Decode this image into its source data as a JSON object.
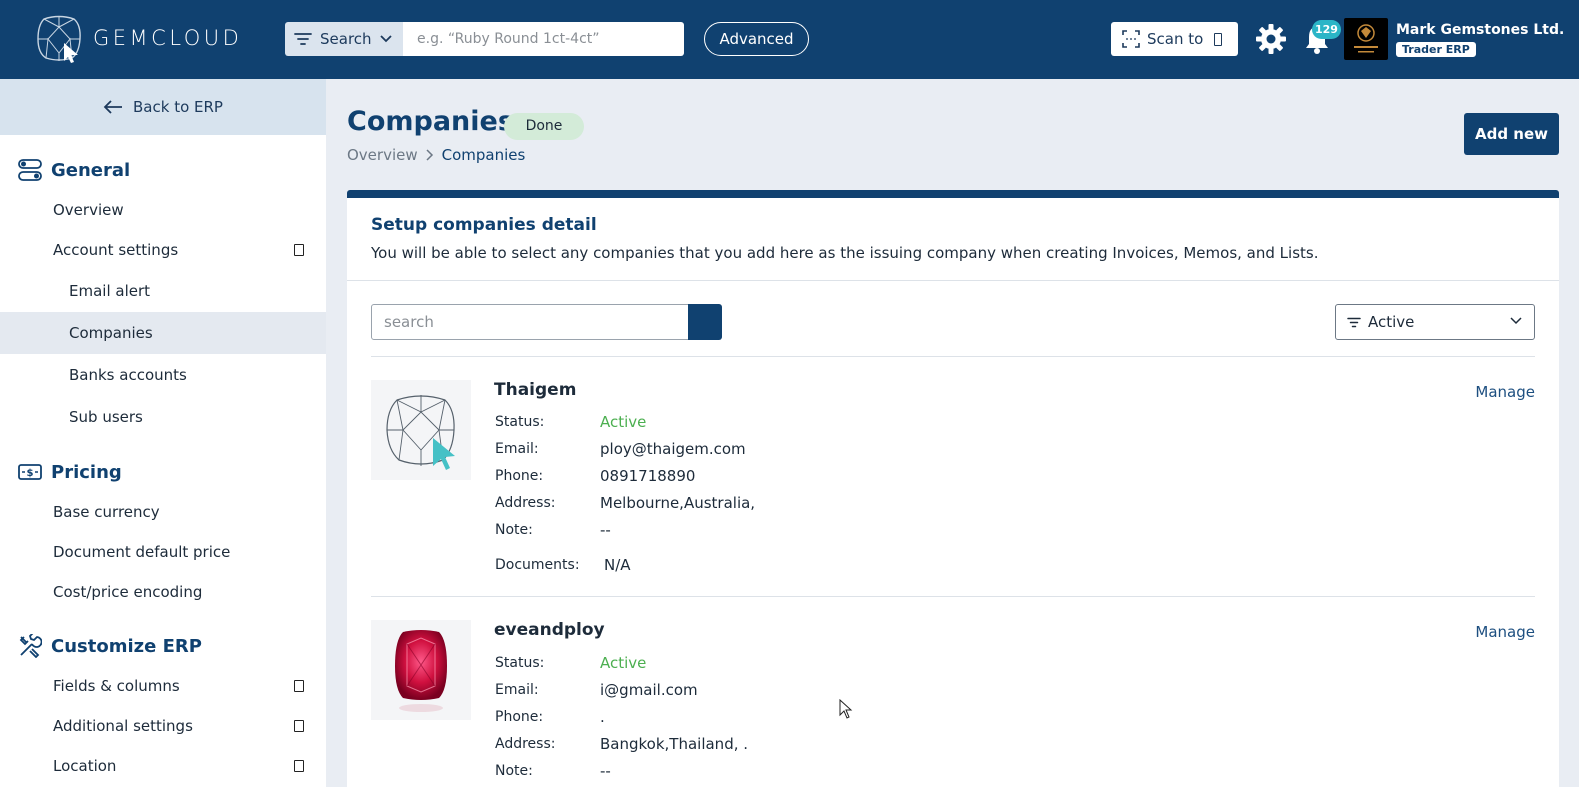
{
  "header": {
    "brand": "GEMCLOUD",
    "search_type_label": "Search",
    "search_placeholder": "e.g. “Ruby Round 1ct-4ct”",
    "advanced_label": "Advanced",
    "scan_label": "Scan to",
    "notification_count": "129",
    "company_name": "Mark Gemstones Ltd.",
    "company_tag": "Trader ERP",
    "accent": "#104170"
  },
  "sidebar": {
    "back_label": "Back to ERP",
    "sections": [
      {
        "title": "General",
        "icon": "toggles-icon",
        "items": [
          {
            "label": "Overview"
          },
          {
            "label": "Account settings",
            "expandable": true
          },
          {
            "label": "Email alert",
            "sub": true
          },
          {
            "label": "Companies",
            "sub": true,
            "active": true
          },
          {
            "label": "Banks accounts",
            "sub": true
          },
          {
            "label": "Sub users",
            "sub": true
          }
        ]
      },
      {
        "title": "Pricing",
        "icon": "price-tag-icon",
        "items": [
          {
            "label": "Base currency"
          },
          {
            "label": "Document default price"
          },
          {
            "label": "Cost/price encoding"
          }
        ]
      },
      {
        "title": "Customize ERP",
        "icon": "tools-icon",
        "items": [
          {
            "label": "Fields & columns",
            "expandable": true
          },
          {
            "label": "Additional settings",
            "expandable": true
          },
          {
            "label": "Location",
            "expandable": true
          }
        ]
      }
    ]
  },
  "page": {
    "title": "Companies",
    "status_badge": "Done",
    "breadcrumb": [
      "Overview",
      "Companies"
    ],
    "add_button": "Add new"
  },
  "card": {
    "title": "Setup companies detail",
    "description": "You will be able to select any companies that you add here as the issuing company when creating Invoices, Memos, and Lists.",
    "search_placeholder": "search",
    "filter_value": "Active",
    "labels": {
      "status": "Status:",
      "email": "Email:",
      "phone": "Phone:",
      "address": "Address:",
      "note": "Note:",
      "documents": "Documents:",
      "manage": "Manage"
    },
    "companies": [
      {
        "name": "Thaigem",
        "status": "Active",
        "email": "ploy@thaigem.com",
        "phone": "0891718890",
        "address": "Melbourne,Australia,",
        "note": "--",
        "documents": "N/A"
      },
      {
        "name": "eveandploy",
        "status": "Active",
        "email": "i@gmail.com",
        "phone": ".",
        "address": "Bangkok,Thailand, .",
        "note": "--"
      }
    ]
  }
}
